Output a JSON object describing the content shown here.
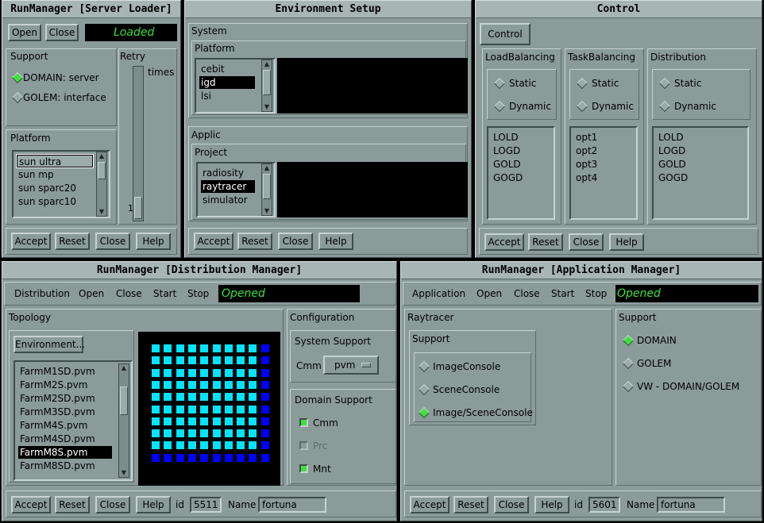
{
  "server_loader": {
    "title": "RunManager [Server Loader]",
    "open": "Open",
    "close": "Close",
    "status": "Loaded",
    "support_label": "Support",
    "support_options": [
      "DOMAIN: server",
      "GOLEM:  interface"
    ],
    "retry_label": "Retry",
    "times_label": "times",
    "retry_value": "1",
    "platform_label": "Platform",
    "platforms": [
      "sun ultra",
      "sun mp",
      "sun sparc20",
      "sun sparc10"
    ],
    "buttons": [
      "Accept",
      "Reset",
      "Close",
      "Help"
    ]
  },
  "env_setup": {
    "title": "Environment Setup",
    "system_label": "System",
    "platform_label": "Platform",
    "platforms": [
      "cebit",
      "igd",
      "lsi"
    ],
    "applic_label": "Applic",
    "project_label": "Project",
    "projects": [
      "radiosity",
      "raytracer",
      "simulator"
    ],
    "buttons": [
      "Accept",
      "Reset",
      "Close",
      "Help"
    ]
  },
  "control": {
    "title": "Control",
    "tab": "Control",
    "columns": [
      {
        "label": "LoadBalancing",
        "options": [
          "Static",
          "Dynamic"
        ],
        "items": [
          "LOLD",
          "LOGD",
          "GOLD",
          "GOGD"
        ]
      },
      {
        "label": "TaskBalancing",
        "options": [
          "Static",
          "Dynamic"
        ],
        "items": [
          "opt1",
          "opt2",
          "opt3",
          "opt4"
        ]
      },
      {
        "label": "Distribution",
        "options": [
          "Static",
          "Dynamic"
        ],
        "items": [
          "LOLD",
          "LOGD",
          "GOLD",
          "GOGD"
        ]
      }
    ],
    "buttons": [
      "Accept",
      "Reset",
      "Close",
      "Help"
    ]
  },
  "dist_manager": {
    "title": "RunManager [Distribution Manager]",
    "menu": [
      "Distribution",
      "Open",
      "Close",
      "Start",
      "Stop"
    ],
    "status": "Opened",
    "topology_label": "Topology",
    "environment_button": "Environment...",
    "files": [
      "FarmM1SD.pvm",
      "FarmM2S.pvm",
      "FarmM2SD.pvm",
      "FarmM3SD.pvm",
      "FarmM4S.pvm",
      "FarmM4SD.pvm",
      "FarmM8S.pvm",
      "FarmM8SD.pvm"
    ],
    "configuration_label": "Configuration",
    "system_support_label": "System Support",
    "cmm_label": "Cmm",
    "cmm_value": "pvm",
    "domain_support_label": "Domain Support",
    "domain_options": [
      "Cmm",
      "Prc",
      "Mnt"
    ],
    "buttons": [
      "Accept",
      "Reset",
      "Close",
      "Help"
    ],
    "id_label": "id",
    "id_value": "5511",
    "name_label": "Name",
    "name_value": "fortuna"
  },
  "app_manager": {
    "title": "RunManager [Application Manager]",
    "menu": [
      "Application",
      "Open",
      "Close",
      "Start",
      "Stop"
    ],
    "status": "Opened",
    "raytracer_label": "Raytracer",
    "support_label": "Support",
    "consoles": [
      "ImageConsole",
      "SceneConsole",
      "Image/SceneConsole"
    ],
    "support_right_label": "Support",
    "support_options": [
      "DOMAIN",
      "GOLEM",
      "VW - DOMAIN/GOLEM"
    ],
    "buttons": [
      "Accept",
      "Reset",
      "Close",
      "Help"
    ],
    "id_label": "id",
    "id_value": "5601",
    "name_label": "Name",
    "name_value": "fortuna"
  },
  "colors": {
    "panel": "#8a9b9a",
    "status_text": "#3ee03e",
    "grid_cyan": "#00e5ff",
    "grid_blue": "#0000ff"
  }
}
